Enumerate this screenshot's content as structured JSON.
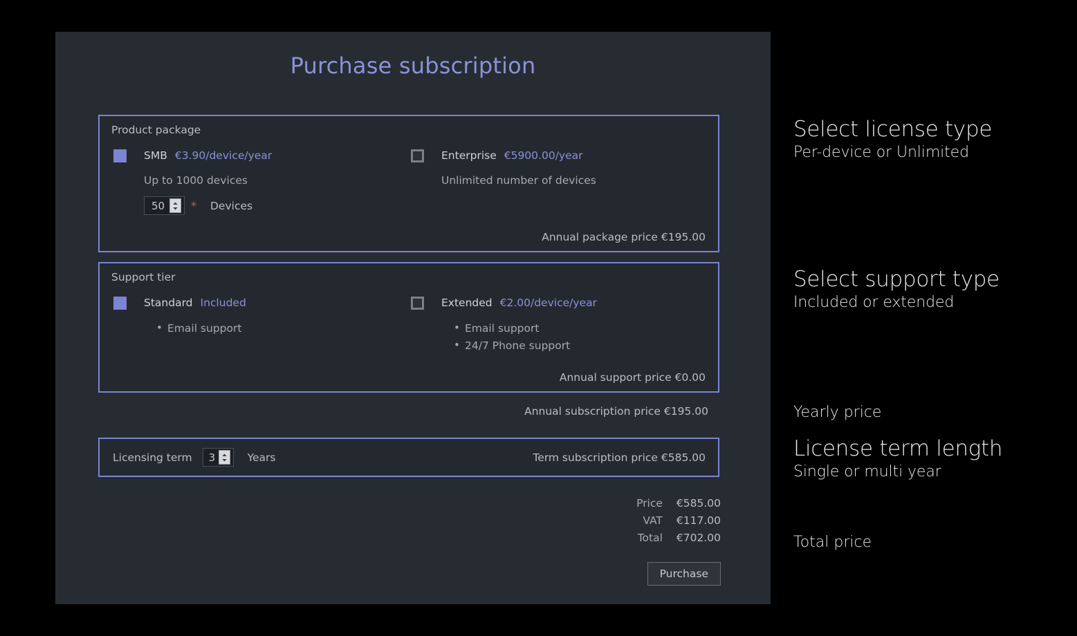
{
  "page": {
    "title": "Purchase subscription",
    "background_color": "#000000",
    "card_color": "#272c33",
    "accent_color": "#7c84d4"
  },
  "product_package": {
    "legend": "Product package",
    "options": [
      {
        "name": "SMB",
        "price": "€3.90/device/year",
        "description": "Up to 1000 devices",
        "selected": true,
        "checkbox_state": "checked"
      },
      {
        "name": "Enterprise",
        "price": "€5900.00/year",
        "description": "Unlimited number of devices",
        "selected": false,
        "checkbox_state": "unchecked"
      }
    ],
    "devices_field": {
      "value": "50",
      "label": "Devices",
      "required_marker": "*"
    },
    "footer_price": "Annual package price €195.00"
  },
  "support_tier": {
    "legend": "Support tier",
    "options": [
      {
        "name": "Standard",
        "price": "Included",
        "selected": true,
        "checkbox_state": "checked",
        "features": [
          "Email support"
        ]
      },
      {
        "name": "Extended",
        "price": "€2.00/device/year",
        "selected": false,
        "checkbox_state": "unchecked",
        "features": [
          "Email support",
          "24/7 Phone support"
        ]
      }
    ],
    "footer_price": "Annual support price €0.00"
  },
  "annual_subscription_line": "Annual subscription price €195.00",
  "licensing_term": {
    "label": "Licensing term",
    "value": "3",
    "unit": "Years",
    "term_price": "Term subscription price €585.00"
  },
  "summary": {
    "rows": [
      {
        "label": "Price",
        "value": "€585.00"
      },
      {
        "label": "VAT",
        "value": "€117.00"
      },
      {
        "label": "Total",
        "value": "€702.00"
      }
    ],
    "purchase_button": "Purchase"
  },
  "annotations": [
    {
      "title": "Select license type",
      "subtitle": "Per-device or Unlimited"
    },
    {
      "title": "Select support type",
      "subtitle": "Included or extended"
    },
    {
      "title": "Yearly price",
      "subtitle": ""
    },
    {
      "title": "License term length",
      "subtitle": "Single or multi year"
    },
    {
      "title": "Total price",
      "subtitle": ""
    }
  ]
}
